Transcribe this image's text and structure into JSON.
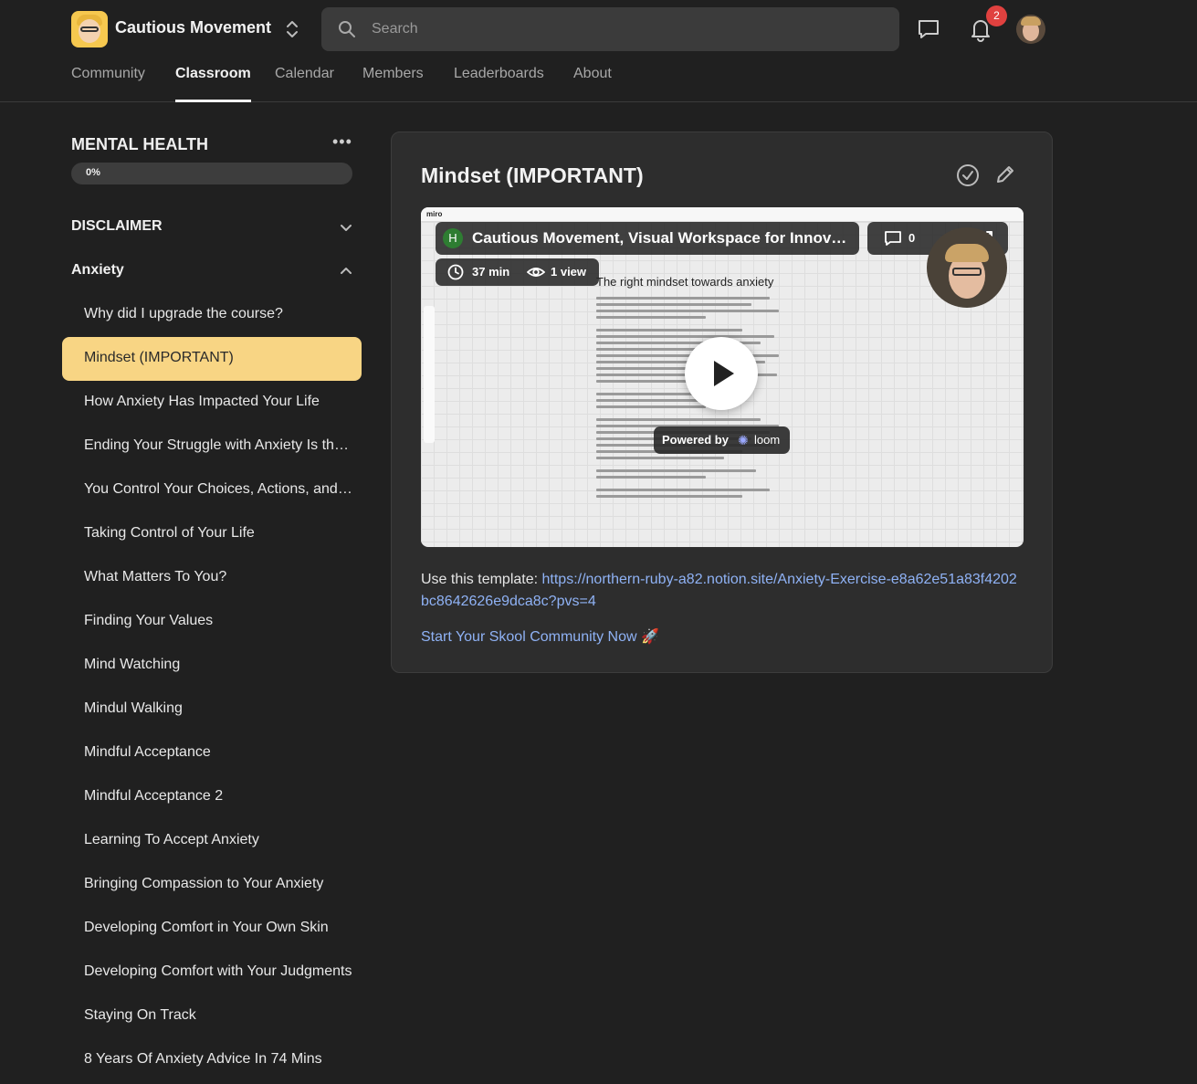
{
  "header": {
    "community_name": "Cautious Movement",
    "search_placeholder": "Search",
    "notification_count": "2"
  },
  "tabs": [
    {
      "label": "Community",
      "active": false
    },
    {
      "label": "Classroom",
      "active": true
    },
    {
      "label": "Calendar",
      "active": false
    },
    {
      "label": "Members",
      "active": false
    },
    {
      "label": "Leaderboards",
      "active": false
    },
    {
      "label": "About",
      "active": false
    }
  ],
  "course": {
    "title": "MENTAL HEALTH",
    "progress_label": "0%",
    "progress_fraction": 0.0,
    "sections": [
      {
        "label": "DISCLAIMER",
        "expanded": false
      },
      {
        "label": "Anxiety",
        "expanded": true
      }
    ],
    "lessons": [
      "Why did I upgrade the course?",
      "Mindset (IMPORTANT)",
      "How Anxiety Has Impacted Your Life",
      "Ending Your Struggle with Anxiety Is the Key to Recovery",
      "You Control Your Choices, Actions, and Behaviors",
      "Taking Control of Your Life",
      "What Matters To You?",
      "Finding Your Values",
      "Mind Watching",
      "Mindul Walking",
      "Mindful Acceptance",
      "Mindful Acceptance 2",
      "Learning To Accept Anxiety",
      "Bringing Compassion to Your Anxiety",
      "Developing Comfort in Your Own Skin",
      "Developing Comfort with Your Judgments",
      "Staying On Track",
      "8 Years Of Anxiety Advice In 74 Mins"
    ],
    "active_lesson_index": 1
  },
  "lesson": {
    "title": "Mindset (IMPORTANT)",
    "video": {
      "channel_initial": "H",
      "title": "Cautious Movement, Visual Workspace for Innovation",
      "comment_count": "0",
      "duration": "37 min",
      "views": "1 view",
      "board_heading": "The right mindset towards anxiety",
      "powered_by": "Powered by",
      "brand": "loom",
      "miro_logo": "miro"
    },
    "template_prefix": "Use this template: ",
    "template_url": "https://northern-ruby-a82.notion.site/Anxiety-Exercise-e8a62e51a83f4202bc8642626e9dca8c?pvs=4",
    "cta_label": "Start Your Skool Community Now 🚀"
  },
  "colors": {
    "background": "#202020",
    "card": "#2d2d2d",
    "active_lesson": "#f8d584",
    "link": "#8fb2f5",
    "badge": "#e0413f"
  }
}
